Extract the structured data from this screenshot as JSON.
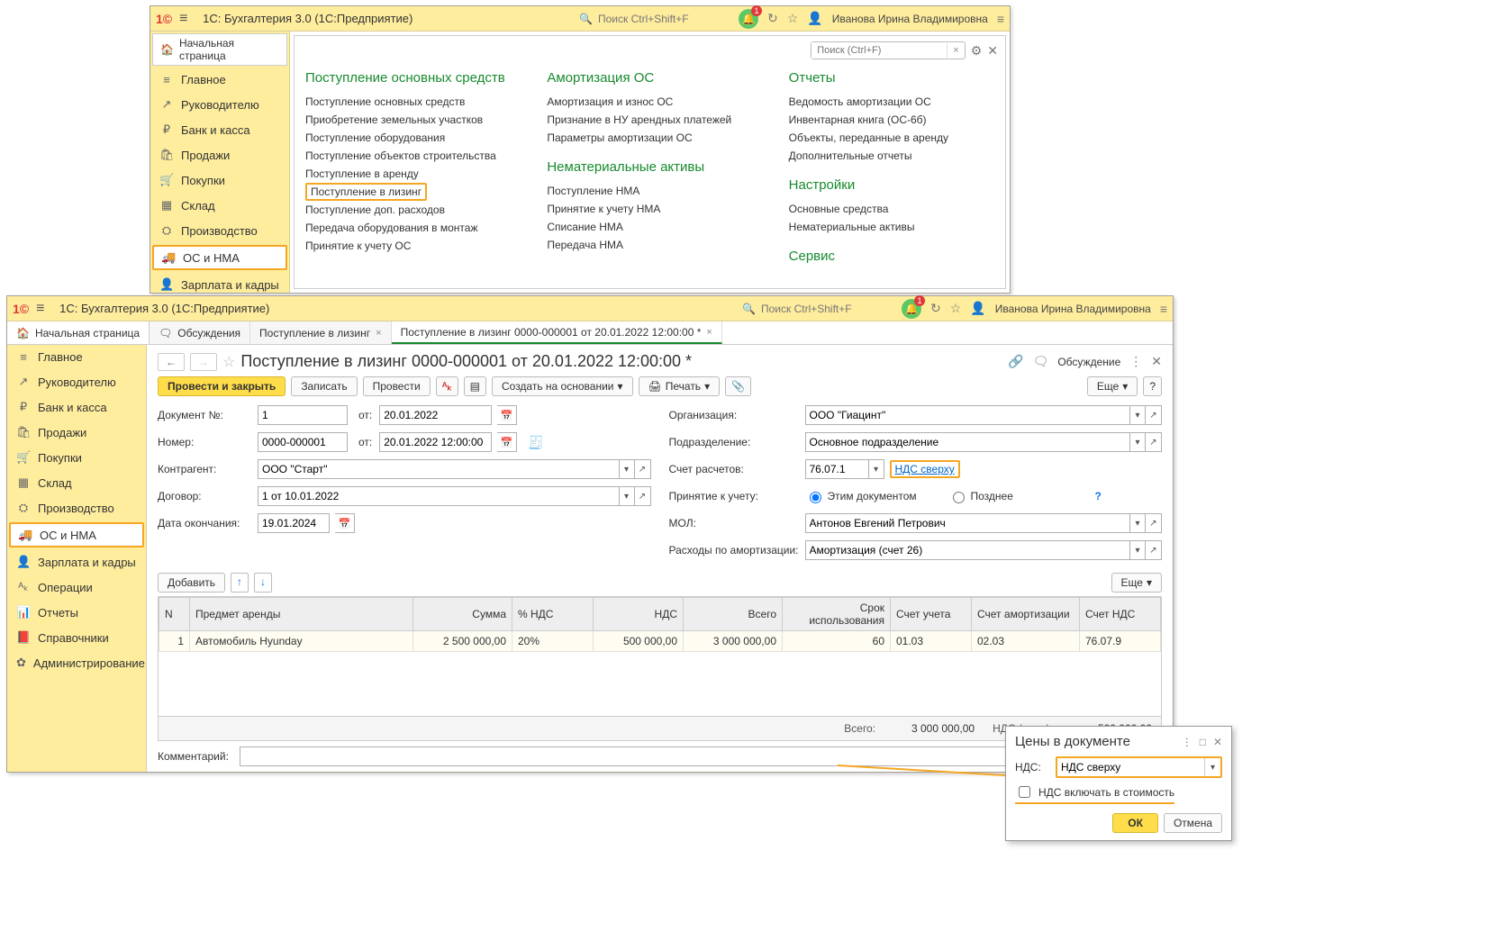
{
  "win1": {
    "title": "1С: Бухгалтерия 3.0  (1С:Предприятие)",
    "search_placeholder": "Поиск Ctrl+Shift+F",
    "badge": "1",
    "user": "Иванова Ирина Владимировна",
    "home_tab": "Начальная страница",
    "sidebar": [
      {
        "icon": "≡",
        "label": "Главное"
      },
      {
        "icon": "↗",
        "label": "Руководителю"
      },
      {
        "icon": "₽",
        "label": "Банк и касса"
      },
      {
        "icon": "🛍",
        "label": "Продажи"
      },
      {
        "icon": "🛒",
        "label": "Покупки"
      },
      {
        "icon": "▦",
        "label": "Склад"
      },
      {
        "icon": "⛭",
        "label": "Производство"
      },
      {
        "icon": "🚚",
        "label": "ОС и НМА"
      },
      {
        "icon": "👤",
        "label": "Зарплата и кадры"
      }
    ],
    "panel_search_placeholder": "Поиск (Ctrl+F)",
    "cols": {
      "c1": {
        "h": "Поступление основных средств",
        "links": [
          "Поступление основных средств",
          "Приобретение земельных участков",
          "Поступление оборудования",
          "Поступление объектов строительства",
          "Поступление в аренду",
          "Поступление в лизинг",
          "Поступление доп. расходов",
          "Передача оборудования в монтаж",
          "Принятие к учету ОС"
        ]
      },
      "c2a": {
        "h": "Амортизация ОС",
        "links": [
          "Амортизация и износ ОС",
          "Признание в НУ арендных платежей",
          "Параметры амортизации ОС"
        ]
      },
      "c2b": {
        "h": "Нематериальные активы",
        "links": [
          "Поступление НМА",
          "Принятие к учету НМА",
          "Списание НМА",
          "Передача НМА"
        ]
      },
      "c3a": {
        "h": "Отчеты",
        "links": [
          "Ведомость амортизации ОС",
          "Инвентарная книга (ОС-6б)",
          "Объекты, переданные в аренду",
          "Дополнительные отчеты"
        ]
      },
      "c3b": {
        "h": "Настройки",
        "links": [
          "Основные средства",
          "Нематериальные активы"
        ]
      },
      "c3c": {
        "h": "Сервис"
      }
    }
  },
  "win2": {
    "title": "1С: Бухгалтерия 3.0  (1С:Предприятие)",
    "search_placeholder": "Поиск Ctrl+Shift+F",
    "badge": "1",
    "user": "Иванова Ирина Владимировна",
    "start_tab": "Начальная страница",
    "tabs": [
      {
        "label": "Обсуждения",
        "active": false,
        "icon": "🗨"
      },
      {
        "label": "Поступление в лизинг",
        "active": false,
        "closable": true
      },
      {
        "label": "Поступление в лизинг 0000-000001 от 20.01.2022 12:00:00 *",
        "active": true,
        "closable": true
      }
    ],
    "sidebar": [
      {
        "icon": "≡",
        "label": "Главное"
      },
      {
        "icon": "↗",
        "label": "Руководителю"
      },
      {
        "icon": "₽",
        "label": "Банк и касса"
      },
      {
        "icon": "🛍",
        "label": "Продажи"
      },
      {
        "icon": "🛒",
        "label": "Покупки"
      },
      {
        "icon": "▦",
        "label": "Склад"
      },
      {
        "icon": "⛭",
        "label": "Производство"
      },
      {
        "icon": "🚚",
        "label": "ОС и НМА"
      },
      {
        "icon": "👤",
        "label": "Зарплата и кадры"
      },
      {
        "icon": "ᴬₖ",
        "label": "Операции"
      },
      {
        "icon": "📊",
        "label": "Отчеты"
      },
      {
        "icon": "📕",
        "label": "Справочники"
      },
      {
        "icon": "✿",
        "label": "Администрирование"
      }
    ],
    "doc_title": "Поступление в лизинг 0000-000001 от 20.01.2022 12:00:00 *",
    "discussion_link": "Обсуждение",
    "cmdbar": {
      "post_close": "Провести и закрыть",
      "save": "Записать",
      "post": "Провести",
      "create_based": "Создать на основании",
      "print": "Печать",
      "more": "Еще"
    },
    "form": {
      "doc_no_lbl": "Документ №:",
      "doc_no": "1",
      "ot": "от:",
      "doc_date": "20.01.2022",
      "num_lbl": "Номер:",
      "num": "0000-000001",
      "num_dt": "20.01.2022 12:00:00",
      "ctr_lbl": "Контрагент:",
      "ctr": "ООО \"Старт\"",
      "dog_lbl": "Договор:",
      "dog": "1 от 10.01.2022",
      "end_lbl": "Дата окончания:",
      "end": "19.01.2024",
      "org_lbl": "Организация:",
      "org": "ООО \"Гиацинт\"",
      "pod_lbl": "Подразделение:",
      "pod": "Основное подразделение",
      "acc_lbl": "Счет расчетов:",
      "acc": "76.07.1",
      "nds_link": "НДС сверху",
      "prin_lbl": "Принятие к учету:",
      "prin_a": "Этим документом",
      "prin_b": "Позднее",
      "mol_lbl": "МОЛ:",
      "mol": "Антонов Евгений Петрович",
      "amort_lbl": "Расходы по амортизации:",
      "amort": "Амортизация (счет 26)"
    },
    "tbl": {
      "add": "Добавить",
      "more": "Еще",
      "headers": [
        "N",
        "Предмет аренды",
        "Сумма",
        "% НДС",
        "НДС",
        "Всего",
        "Срок использования",
        "Счет учета",
        "Счет амортизации",
        "Счет НДС"
      ],
      "rows": [
        {
          "n": "1",
          "subj": "Автомобиль Hyunday",
          "sum": "2 500 000,00",
          "pct": "20%",
          "nds": "500 000,00",
          "total": "3 000 000,00",
          "term": "60",
          "acc": "01.03",
          "amort": "02.03",
          "ndsacc": "76.07.9"
        }
      ]
    },
    "totals": {
      "all_lbl": "Всего:",
      "all": "3 000 000,00",
      "nds_lbl": "НДС (в т.ч.):",
      "nds": "500 000,00"
    },
    "comment_lbl": "Комментарий:"
  },
  "popup": {
    "title": "Цены в документе",
    "nds_lbl": "НДС:",
    "nds_val": "НДС сверху",
    "chk_lbl": "НДС включать в стоимость",
    "ok": "ОК",
    "cancel": "Отмена"
  }
}
